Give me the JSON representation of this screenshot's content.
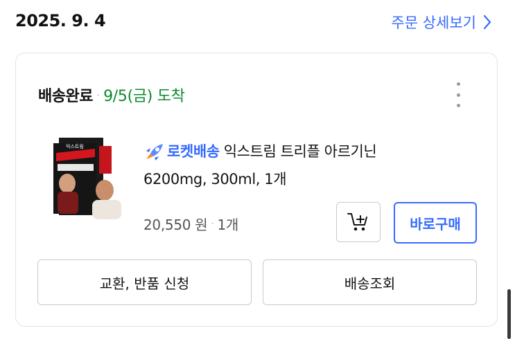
{
  "order": {
    "date": "2025. 9. 4",
    "detail_link": "주문 상세보기"
  },
  "shipment": {
    "status": "배송완료",
    "separator": "·",
    "arrival": "9/5(금) 도착"
  },
  "product": {
    "badge": "로켓배송",
    "name_line1": "익스트림 트리플 아르기닌",
    "name_line2": "6200mg, 300ml, 1개",
    "price": "20,550 원",
    "quantity": "1개",
    "image_icon": "product-thumbnail",
    "packaging_text": "익스트림"
  },
  "buttons": {
    "buy_now": "바로구매",
    "exchange_return": "교환, 반품 신청",
    "tracking": "배송조회"
  },
  "icons": {
    "detail": "chevron-right-icon",
    "more": "more-vertical-icon",
    "cart": "cart-add-icon",
    "rocket": "rocket-icon"
  },
  "colors": {
    "accent": "#346aff",
    "arrival": "#0b8a2e",
    "text": "#111111",
    "muted": "#555555",
    "border": "#c9c9c9"
  }
}
